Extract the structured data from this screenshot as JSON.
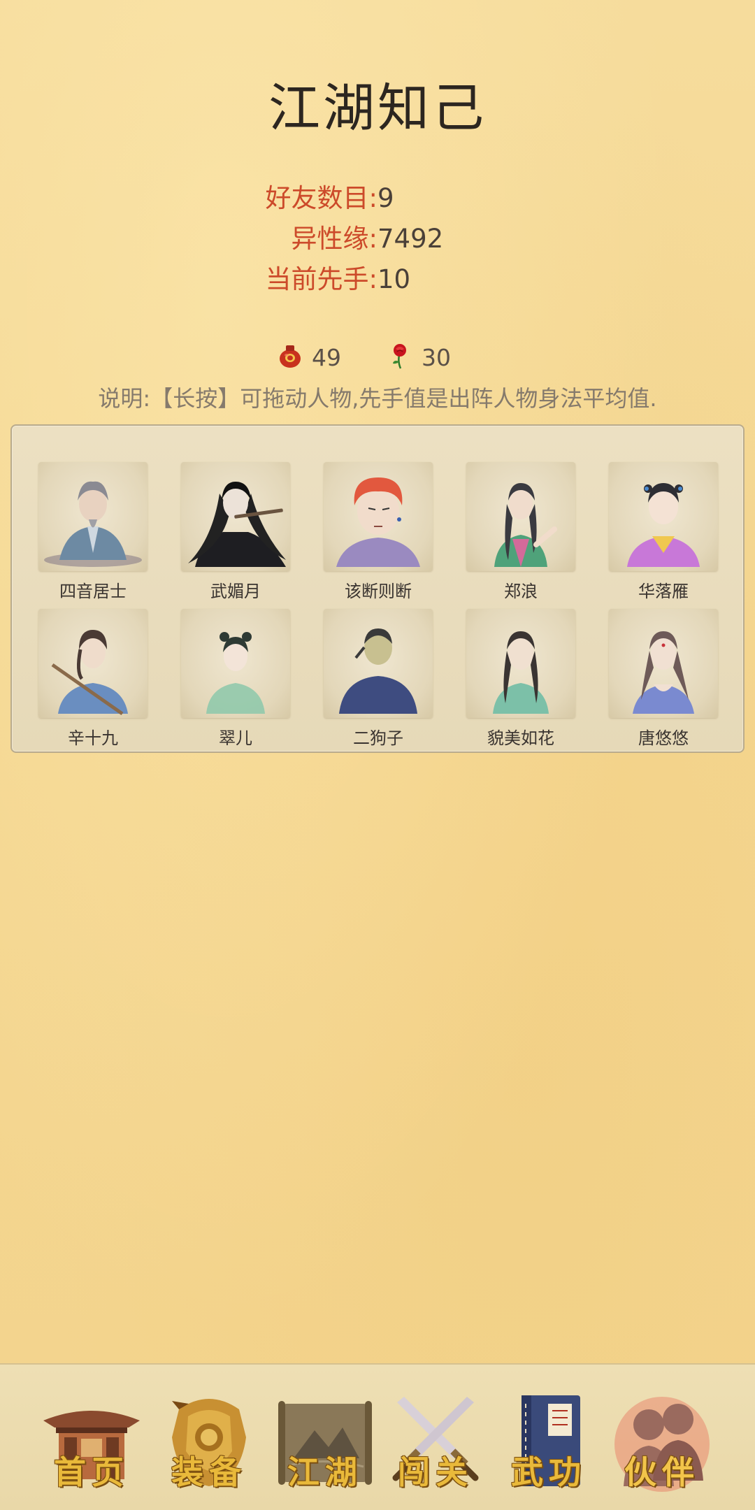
{
  "header": {
    "title": "江湖知己"
  },
  "stats": [
    {
      "label": "好友数目:",
      "value": "9"
    },
    {
      "label": "异性缘:",
      "value": "7492"
    },
    {
      "label": "当前先手:",
      "value": "10"
    }
  ],
  "currency": [
    {
      "icon": "wine-jar-icon",
      "value": "49"
    },
    {
      "icon": "rose-icon",
      "value": "30"
    }
  ],
  "note": "说明:【长按】可拖动人物,先手值是出阵人物身法平均值.",
  "partners": [
    {
      "name": "四音居士"
    },
    {
      "name": "武媚月"
    },
    {
      "name": "该断则断"
    },
    {
      "name": "郑浪"
    },
    {
      "name": "华落雁"
    },
    {
      "name": "辛十九"
    },
    {
      "name": "翠儿"
    },
    {
      "name": "二狗子"
    },
    {
      "name": "貌美如花"
    },
    {
      "name": "唐悠悠"
    }
  ],
  "nav": {
    "active": "伙伴",
    "items": [
      {
        "label": "首页",
        "icon": "pavilion-icon"
      },
      {
        "label": "装备",
        "icon": "armor-icon"
      },
      {
        "label": "江湖",
        "icon": "scroll-map-icon"
      },
      {
        "label": "闯关",
        "icon": "crossed-swords-icon"
      },
      {
        "label": "武功",
        "icon": "book-icon"
      },
      {
        "label": "伙伴",
        "icon": "companions-icon"
      }
    ]
  },
  "colors": {
    "background": "#f5d894",
    "label_red": "#cc4a2a",
    "value_dark": "#4a4038",
    "note_gray": "#857a6c",
    "tab_gold": "#e9b93a"
  }
}
